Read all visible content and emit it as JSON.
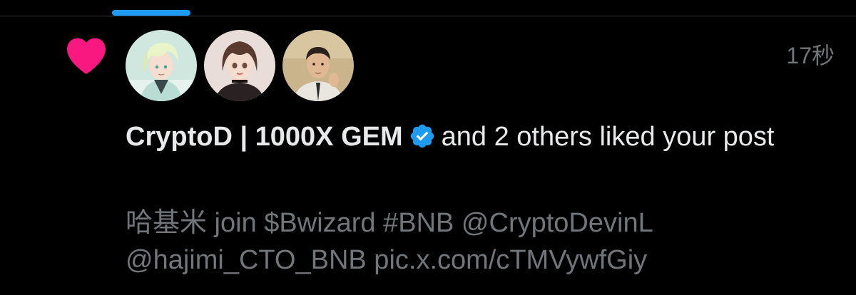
{
  "colors": {
    "background": "#000000",
    "accent": "#1d9bf0",
    "like": "#f91880",
    "primary_text": "#e7e9ea",
    "secondary_text": "#71767b"
  },
  "notification": {
    "type_icon": "heart-icon",
    "timestamp": "17秒",
    "actor_name": "CryptoD | 1000X GEM",
    "verified_icon": "verified-badge-icon",
    "action_text": "and 2 others liked your post",
    "post_snippet": "哈基米 join $Bwizard #BNB @CryptoDevinL\n@hajimi_CTO_BNB pic.x.com/cTMVywfGiy",
    "avatars": [
      {
        "icon": "avatar-anime-boy"
      },
      {
        "icon": "avatar-anime-girl"
      },
      {
        "icon": "avatar-man"
      }
    ]
  }
}
